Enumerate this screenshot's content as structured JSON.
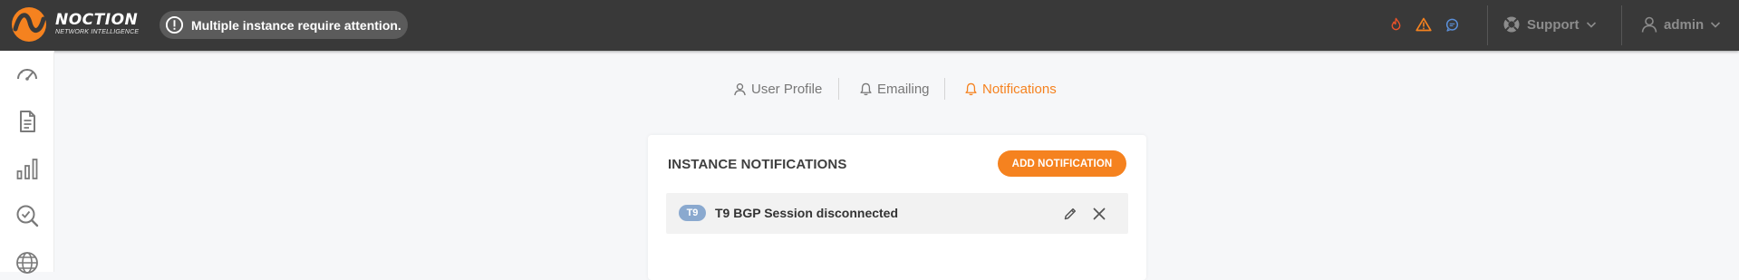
{
  "brand": {
    "name": "NOCTION",
    "tagline": "NETWORK INTELLIGENCE",
    "accent": "#f5821f"
  },
  "header": {
    "alert": {
      "icon": "exclamation-circle-icon",
      "text": "Multiple instance require attention."
    },
    "status_icons": [
      {
        "icon": "flame-icon",
        "color": "#e8522a"
      },
      {
        "icon": "warning-triangle-icon",
        "color": "#f5821f"
      },
      {
        "icon": "chat-bubble-icon",
        "color": "#5b8fd8"
      }
    ],
    "support": {
      "icon": "lifebuoy-icon",
      "label": "Support"
    },
    "user": {
      "icon": "user-icon",
      "label": "admin"
    }
  },
  "sidebar": {
    "items": [
      {
        "icon": "speedometer-icon"
      },
      {
        "icon": "document-icon"
      },
      {
        "icon": "bar-chart-icon"
      },
      {
        "icon": "search-check-icon"
      },
      {
        "icon": "globe-icon"
      }
    ]
  },
  "tabs": [
    {
      "icon": "user-icon",
      "label": "User Profile",
      "active": false
    },
    {
      "icon": "bell-icon",
      "label": "Emailing",
      "active": false
    },
    {
      "icon": "bell-icon",
      "label": "Notifications",
      "active": true
    }
  ],
  "card": {
    "title": "INSTANCE NOTIFICATIONS",
    "add_button_label": "ADD NOTIFICATION",
    "notifications": [
      {
        "badge": "T9",
        "badge_color": "#8aa9cf",
        "label": "T9 BGP Session disconnected",
        "edit_icon": "pencil-icon",
        "delete_icon": "close-icon"
      }
    ]
  }
}
